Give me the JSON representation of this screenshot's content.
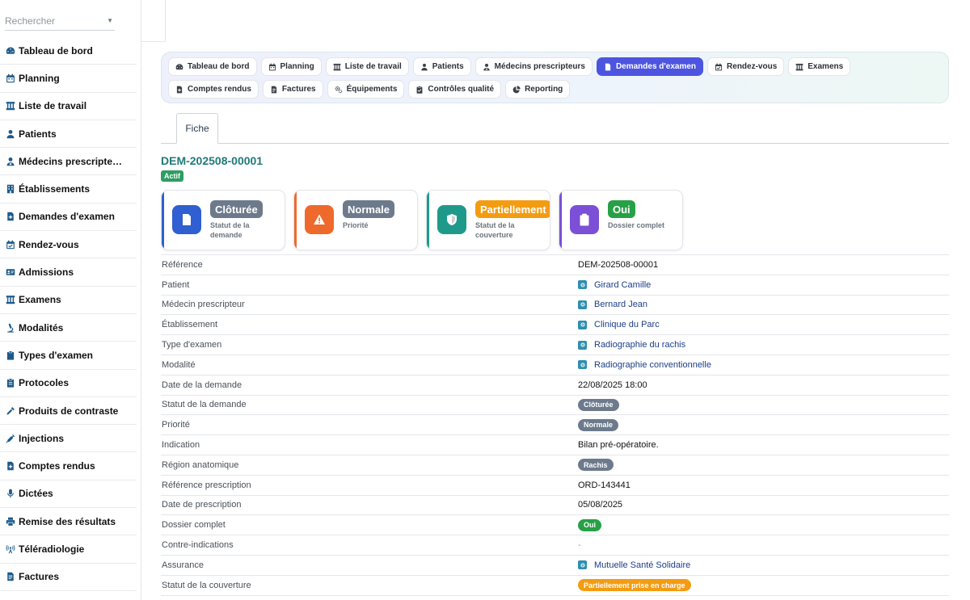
{
  "search": {
    "placeholder": "Rechercher"
  },
  "sidebar": {
    "items": [
      {
        "label": "Tableau de bord",
        "icon": "dashboard-icon"
      },
      {
        "label": "Planning",
        "icon": "calendar-icon"
      },
      {
        "label": "Liste de travail",
        "icon": "worklist-icon"
      },
      {
        "label": "Patients",
        "icon": "user-icon"
      },
      {
        "label": "Médecins prescripte…",
        "icon": "doctor-icon"
      },
      {
        "label": "Établissements",
        "icon": "building-icon"
      },
      {
        "label": "Demandes d'examen",
        "icon": "file-medical-icon"
      },
      {
        "label": "Rendez-vous",
        "icon": "calendar-check-icon"
      },
      {
        "label": "Admissions",
        "icon": "id-card-icon"
      },
      {
        "label": "Examens",
        "icon": "worklist-icon"
      },
      {
        "label": "Modalités",
        "icon": "microscope-icon"
      },
      {
        "label": "Types d'examen",
        "icon": "clipboard-icon"
      },
      {
        "label": "Protocoles",
        "icon": "clipboard-list-icon"
      },
      {
        "label": "Produits de contraste",
        "icon": "eyedropper-icon"
      },
      {
        "label": "Injections",
        "icon": "syringe-icon"
      },
      {
        "label": "Comptes rendus",
        "icon": "file-medical-icon"
      },
      {
        "label": "Dictées",
        "icon": "microphone-icon"
      },
      {
        "label": "Remise des résultats",
        "icon": "printer-icon"
      },
      {
        "label": "Téléradiologie",
        "icon": "broadcast-icon"
      },
      {
        "label": "Factures",
        "icon": "invoice-icon"
      }
    ]
  },
  "topnav": {
    "items": [
      {
        "label": "Tableau de bord",
        "icon": "dashboard-icon",
        "active": false
      },
      {
        "label": "Planning",
        "icon": "calendar-icon",
        "active": false
      },
      {
        "label": "Liste de travail",
        "icon": "worklist-icon",
        "active": false
      },
      {
        "label": "Patients",
        "icon": "user-icon",
        "active": false
      },
      {
        "label": "Médecins prescripteurs",
        "icon": "doctor-icon",
        "active": false
      },
      {
        "label": "Demandes d'examen",
        "icon": "file-medical-icon",
        "active": true
      },
      {
        "label": "Rendez-vous",
        "icon": "calendar-check-icon",
        "active": false
      },
      {
        "label": "Examens",
        "icon": "worklist-icon",
        "active": false
      },
      {
        "label": "Comptes rendus",
        "icon": "file-medical-icon",
        "active": false
      },
      {
        "label": "Factures",
        "icon": "invoice-icon",
        "active": false
      },
      {
        "label": "Équipements",
        "icon": "cogs-icon",
        "active": false
      },
      {
        "label": "Contrôles qualité",
        "icon": "clipboard-check-icon",
        "active": false
      },
      {
        "label": "Reporting",
        "icon": "pie-chart-icon",
        "active": false
      }
    ]
  },
  "tab": {
    "label": "Fiche"
  },
  "record": {
    "title": "DEM-202508-00001",
    "status_badge": "Actif"
  },
  "cards": [
    {
      "value": "Clôturée",
      "label": "Statut de la demande",
      "icon": "file-medical-icon",
      "color": "#2f5fd0",
      "pill_color": "#6c7a8c"
    },
    {
      "value": "Normale",
      "label": "Priorité",
      "icon": "warning-icon",
      "color": "#ee6a2c",
      "pill_color": "#6c7a8c"
    },
    {
      "value": "Partiellement",
      "label": "Statut de la couverture",
      "icon": "shield-icon",
      "color": "#1f9a8a",
      "pill_color": "#f39c12"
    },
    {
      "value": "Oui",
      "label": "Dossier complet",
      "icon": "clipboard-check-icon",
      "color": "#7b4fd6",
      "pill_color": "#27a046"
    }
  ],
  "details": [
    {
      "key": "Référence",
      "type": "text",
      "value": "DEM-202508-00001"
    },
    {
      "key": "Patient",
      "type": "link",
      "value": "Girard Camille"
    },
    {
      "key": "Médecin prescripteur",
      "type": "link",
      "value": "Bernard Jean"
    },
    {
      "key": "Établissement",
      "type": "link",
      "value": "Clinique du Parc"
    },
    {
      "key": "Type d'examen",
      "type": "link",
      "value": "Radiographie du rachis"
    },
    {
      "key": "Modalité",
      "type": "link",
      "value": "Radiographie conventionnelle"
    },
    {
      "key": "Date de la demande",
      "type": "text",
      "value": "22/08/2025 18:00"
    },
    {
      "key": "Statut de la demande",
      "type": "badge",
      "value": "Clôturée",
      "color": "#6c7a8c"
    },
    {
      "key": "Priorité",
      "type": "badge",
      "value": "Normale",
      "color": "#6c7a8c"
    },
    {
      "key": "Indication",
      "type": "text",
      "value": "Bilan pré-opératoire."
    },
    {
      "key": "Région anatomique",
      "type": "badge",
      "value": "Rachis",
      "color": "#6c7a8c"
    },
    {
      "key": "Référence prescription",
      "type": "text",
      "value": "ORD-143441"
    },
    {
      "key": "Date de prescription",
      "type": "text",
      "value": "05/08/2025"
    },
    {
      "key": "Dossier complet",
      "type": "badge",
      "value": "Oui",
      "color": "#27a046"
    },
    {
      "key": "Contre-indications",
      "type": "dash",
      "value": "-"
    },
    {
      "key": "Assurance",
      "type": "link",
      "value": "Mutuelle Santé Solidaire"
    },
    {
      "key": "Statut de la couverture",
      "type": "badge",
      "value": "Partiellement prise en charge",
      "color": "#f39c12"
    }
  ]
}
